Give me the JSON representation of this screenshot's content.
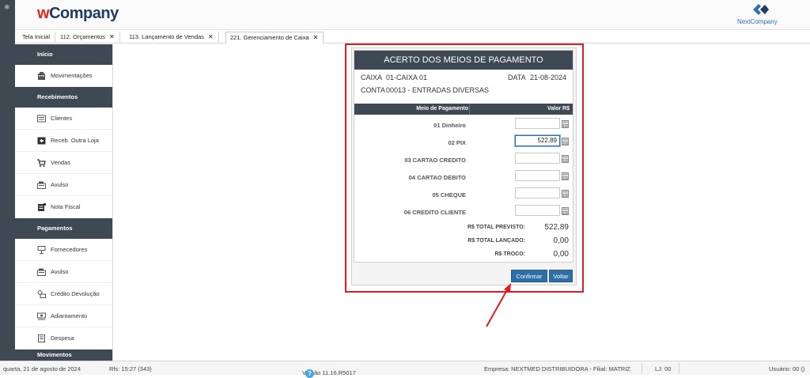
{
  "app": {
    "brand_w": "w",
    "brand_rest": "Company",
    "partner": "NextCompany"
  },
  "tabs": [
    {
      "label": "Tela Inicial",
      "closable": false
    },
    {
      "label": "112. Orçamentos",
      "closable": true
    },
    {
      "label": "113. Lançamento de Vendas",
      "closable": true
    },
    {
      "label": "221. Gerenciamento de Caixa",
      "closable": true
    }
  ],
  "tab_close_glyph": "✕",
  "sidebar": {
    "sections": [
      {
        "title": "Início",
        "items": [
          {
            "label": "Movimentações",
            "icon": "building-icon"
          }
        ]
      },
      {
        "title": "Recebimentos",
        "items": [
          {
            "label": "Clientes",
            "icon": "clients-icon"
          },
          {
            "label": "Receb. Outra Loja",
            "icon": "transfer-icon"
          },
          {
            "label": "Vendas",
            "icon": "cart-icon"
          },
          {
            "label": "Avulso",
            "icon": "cash-register-icon"
          },
          {
            "label": "Nota Fiscal",
            "icon": "invoice-icon"
          }
        ]
      },
      {
        "title": "Pagamentos",
        "items": [
          {
            "label": "Fornecedores",
            "icon": "supplier-icon"
          },
          {
            "label": "Avulso",
            "icon": "cash-register-icon"
          },
          {
            "label": "Crédito Devolução",
            "icon": "refund-icon"
          },
          {
            "label": "Adiantamento",
            "icon": "advance-icon"
          },
          {
            "label": "Despesa",
            "icon": "expense-icon"
          }
        ]
      },
      {
        "title": "Movimentos",
        "items": []
      }
    ]
  },
  "dialog": {
    "title": "ACERTO DOS MEIOS DE PAGAMENTO",
    "caixa_label": "CAIXA",
    "caixa_value": "01-CAIXA 01",
    "data_label": "DATA",
    "data_value": "21-08-2024",
    "conta_label": "CONTA",
    "conta_value": "00013 - ENTRADAS DIVERSAS",
    "col_meio": "Meio de Pagamento",
    "col_valor": "Valor R$",
    "rows": [
      {
        "name": "01 Dinheiro",
        "value": ""
      },
      {
        "name": "02 PIX",
        "value": "522,89"
      },
      {
        "name": "03 CARTAO CREDITO",
        "value": ""
      },
      {
        "name": "04 CARTAO DEBITO",
        "value": ""
      },
      {
        "name": "05 CHEQUE",
        "value": ""
      },
      {
        "name": "06 CREDITO CLIENTE",
        "value": ""
      }
    ],
    "totals": [
      {
        "label": "R$ TOTAL PREVISTO:",
        "value": "522,89"
      },
      {
        "label": "R$ TOTAL LANÇADO:",
        "value": "0,00"
      },
      {
        "label": "R$ TROCO:",
        "value": "0,00"
      }
    ],
    "confirm_label": "Confirmar",
    "back_label": "Voltar"
  },
  "status": {
    "date": "quarta, 21 de agosto de 2024",
    "rfs": "Rfs: 15:27 (343)",
    "version": "Versão 11.16.R5017",
    "help": "?",
    "empresa": "Empresa: NEXTMED DISTRIBUIDORA - Filial: MATRIZ",
    "lj": "LJ: 00",
    "usuario": "Usuário: 00 ()"
  },
  "colors": {
    "dark": "#3e4954",
    "accent": "#2e6fa7",
    "highlight": "#e01b24"
  }
}
